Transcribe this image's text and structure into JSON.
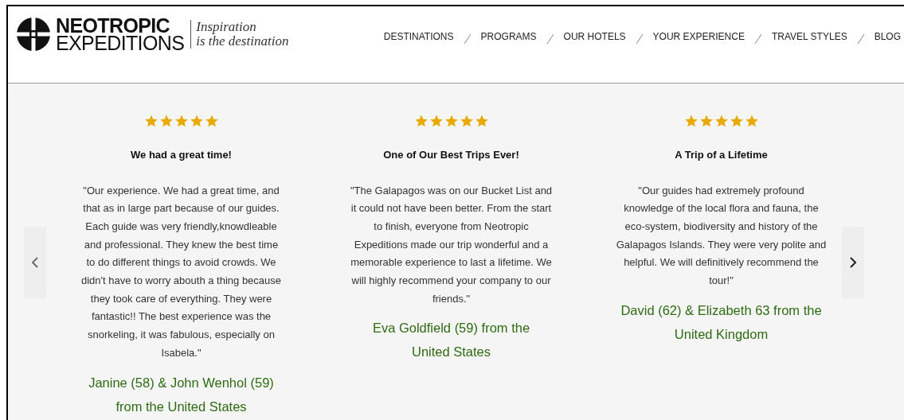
{
  "header": {
    "logo": {
      "line1": "NEOTROPIC",
      "line2": "EXPEDITIONS"
    },
    "tagline": {
      "line1": "Inspiration",
      "line2": "is the destination"
    },
    "nav": [
      "DESTINATIONS",
      "PROGRAMS",
      "OUR HOTELS",
      "YOUR EXPERIENCE",
      "TRAVEL STYLES",
      "BLOG"
    ]
  },
  "reviews": [
    {
      "stars": 5,
      "title": "We had a great time!",
      "quote": "\"Our experience. We had a great time, and that as in large part because of our guides. Each guide was very friendly,knowdleable and professional. They knew the best time to do different things to avoid crowds. We didn't have to worry abouth a thing because they took care of everything. They were fantastic!! The best experience was the snorkeling, it was fabulous, especially on Isabela.\"",
      "author": "Janine (58) & John Wenhol (59) from the United States"
    },
    {
      "stars": 5,
      "title": "One of Our Best Trips Ever!",
      "quote": "\"The Galapagos was on our Bucket List and it could not have been better. From the start to finish, everyone from Neotropic Expeditions made our trip wonderful and a memorable experience to last a lifetime. We will highly recommend your company to our friends.\"",
      "author": "Eva Goldfield (59) from the United States"
    },
    {
      "stars": 5,
      "title": "A Trip of a Lifetime",
      "quote": "\"Our guides had extremely profound knowledge of the local flora and fauna, the eco-system, biodiversity and history of the Galapagos Islands. They were very polite and helpful. We will definitively recommend the tour!\"",
      "author": "David (62) & Elizabeth 63 from the United Kingdom"
    }
  ]
}
